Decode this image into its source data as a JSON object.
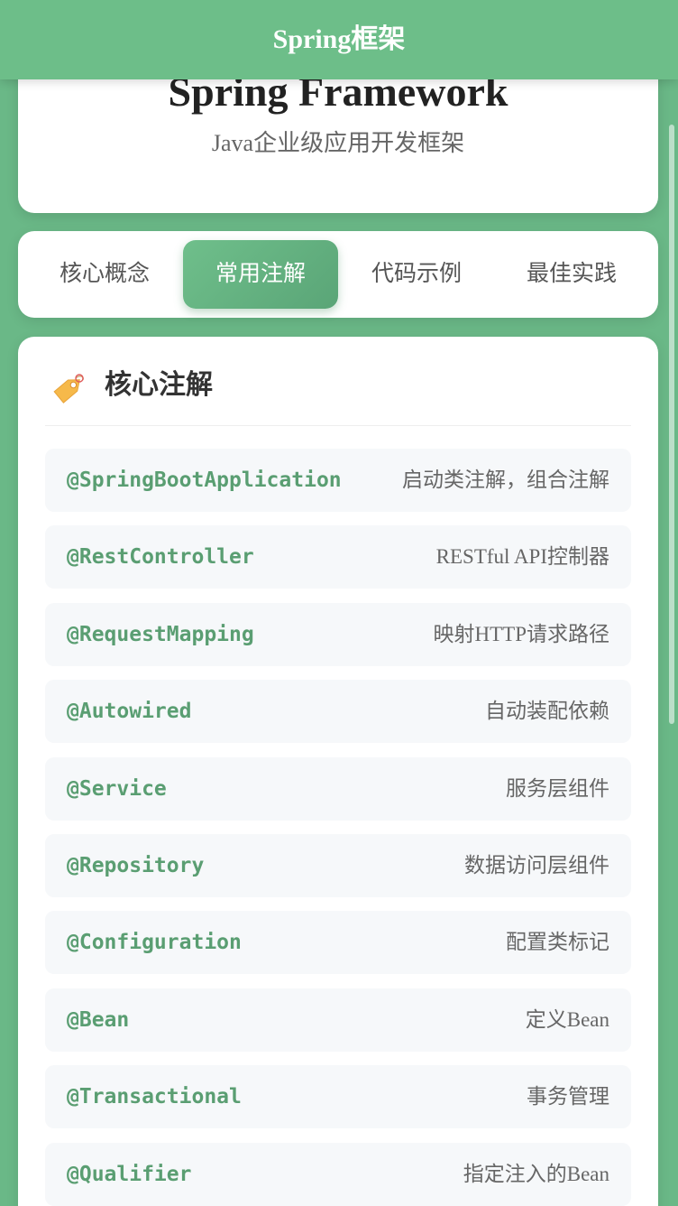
{
  "app": {
    "title": "Spring框架"
  },
  "hero": {
    "title": "Spring Framework",
    "subtitle": "Java企业级应用开发框架"
  },
  "tabs": [
    {
      "label": "核心概念",
      "active": false
    },
    {
      "label": "常用注解",
      "active": true
    },
    {
      "label": "代码示例",
      "active": false
    },
    {
      "label": "最佳实践",
      "active": false
    }
  ],
  "section": {
    "icon": "tag-icon",
    "title": "核心注解"
  },
  "annotations": [
    {
      "name": "@SpringBootApplication",
      "desc": "启动类注解，组合注解"
    },
    {
      "name": "@RestController",
      "desc": "RESTful API控制器"
    },
    {
      "name": "@RequestMapping",
      "desc": "映射HTTP请求路径"
    },
    {
      "name": "@Autowired",
      "desc": "自动装配依赖"
    },
    {
      "name": "@Service",
      "desc": "服务层组件"
    },
    {
      "name": "@Repository",
      "desc": "数据访问层组件"
    },
    {
      "name": "@Configuration",
      "desc": "配置类标记"
    },
    {
      "name": "@Bean",
      "desc": "定义Bean"
    },
    {
      "name": "@Transactional",
      "desc": "事务管理"
    },
    {
      "name": "@Qualifier",
      "desc": "指定注入的Bean"
    }
  ],
  "colors": {
    "background": "#6ab887",
    "accent": "#6dbe89",
    "annotation_text": "#5a9e72"
  }
}
